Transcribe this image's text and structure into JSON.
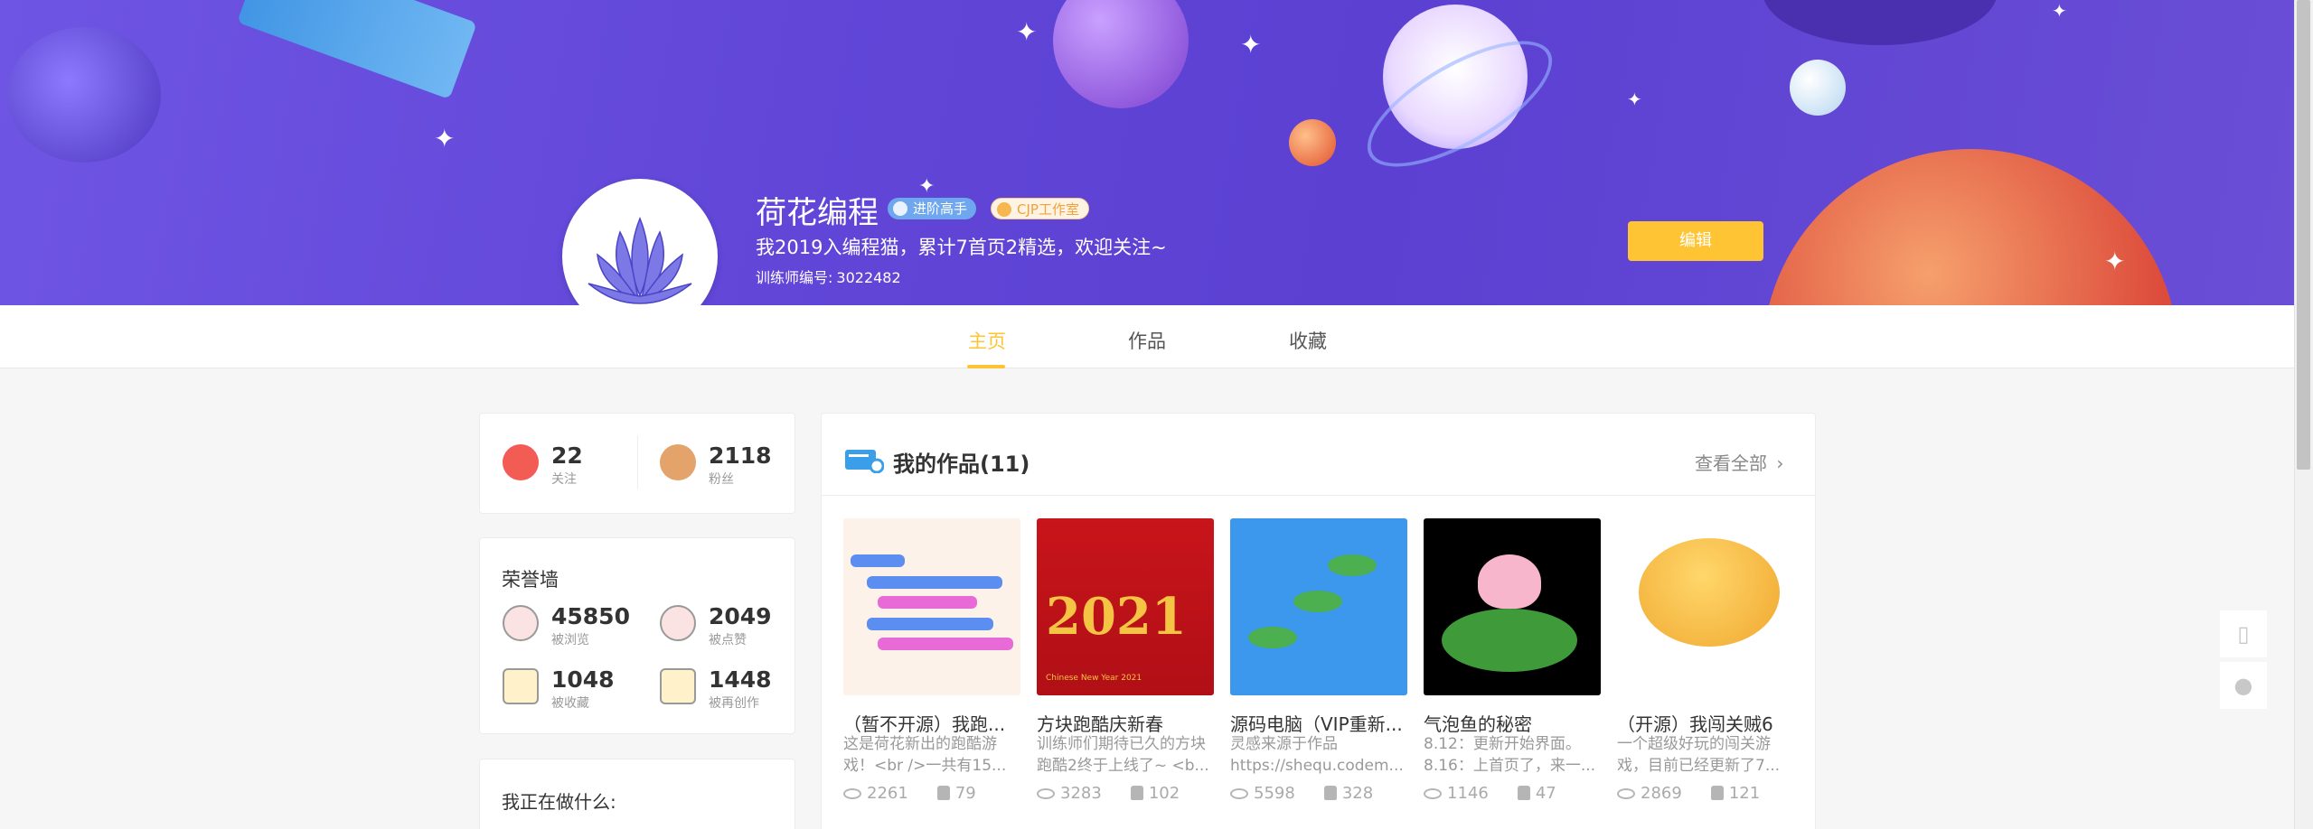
{
  "profile": {
    "name": "荷花编程",
    "level_badge": "进阶高手",
    "studio_badge": "CJP工作室",
    "bio": "我2019入编程猫，累计7首页2精选，欢迎关注~",
    "trainer_id_label": "训练师编号:",
    "trainer_id": "3022482",
    "edit_label": "编辑"
  },
  "tabs": [
    {
      "label": "主页",
      "active": true
    },
    {
      "label": "作品",
      "active": false
    },
    {
      "label": "收藏",
      "active": false
    }
  ],
  "follow": {
    "following_value": "22",
    "following_label": "关注",
    "fans_value": "2118",
    "fans_label": "粉丝"
  },
  "honor": {
    "title": "荣誉墙",
    "items": [
      {
        "value": "45850",
        "label": "被浏览",
        "icon": "eye-icon"
      },
      {
        "value": "2049",
        "label": "被点赞",
        "icon": "thumb-icon"
      },
      {
        "value": "1048",
        "label": "被收藏",
        "icon": "star-box-icon"
      },
      {
        "value": "1448",
        "label": "被再创作",
        "icon": "pencil-icon"
      }
    ]
  },
  "doing": {
    "title": "我正在做什么:"
  },
  "works": {
    "title": "我的作品(11)",
    "view_all": "查看全部",
    "items": [
      {
        "title": "（暂不开源）我跑...",
        "desc": "这是荷花新出的跑酷游戏！<br />一共有15...",
        "views": "2261",
        "likes": "79"
      },
      {
        "title": "方块跑酷庆新春",
        "desc": "训练师们期待已久的方块跑酷2终于上线了~ <b...",
        "views": "3283",
        "likes": "102"
      },
      {
        "title": "源码电脑（VIP重新...",
        "desc": "灵感来源于作品 https://shequ.codem...",
        "views": "5598",
        "likes": "328"
      },
      {
        "title": "气泡鱼的秘密",
        "desc": "8.12：更新开始界面。 8.16：上首页了，来一...",
        "views": "1146",
        "likes": "47"
      },
      {
        "title": "（开源）我闯关贼6",
        "desc": "一个超级好玩的闯关游戏，目前已经更新了7...",
        "views": "2869",
        "likes": "121"
      }
    ],
    "thumb_text_2021": "2021",
    "thumb_caption_2021": "Chinese New Year 2021"
  },
  "colors": {
    "accent": "#fec433",
    "banner": "#6146d8",
    "badge_blue": "#6ea7ee"
  }
}
